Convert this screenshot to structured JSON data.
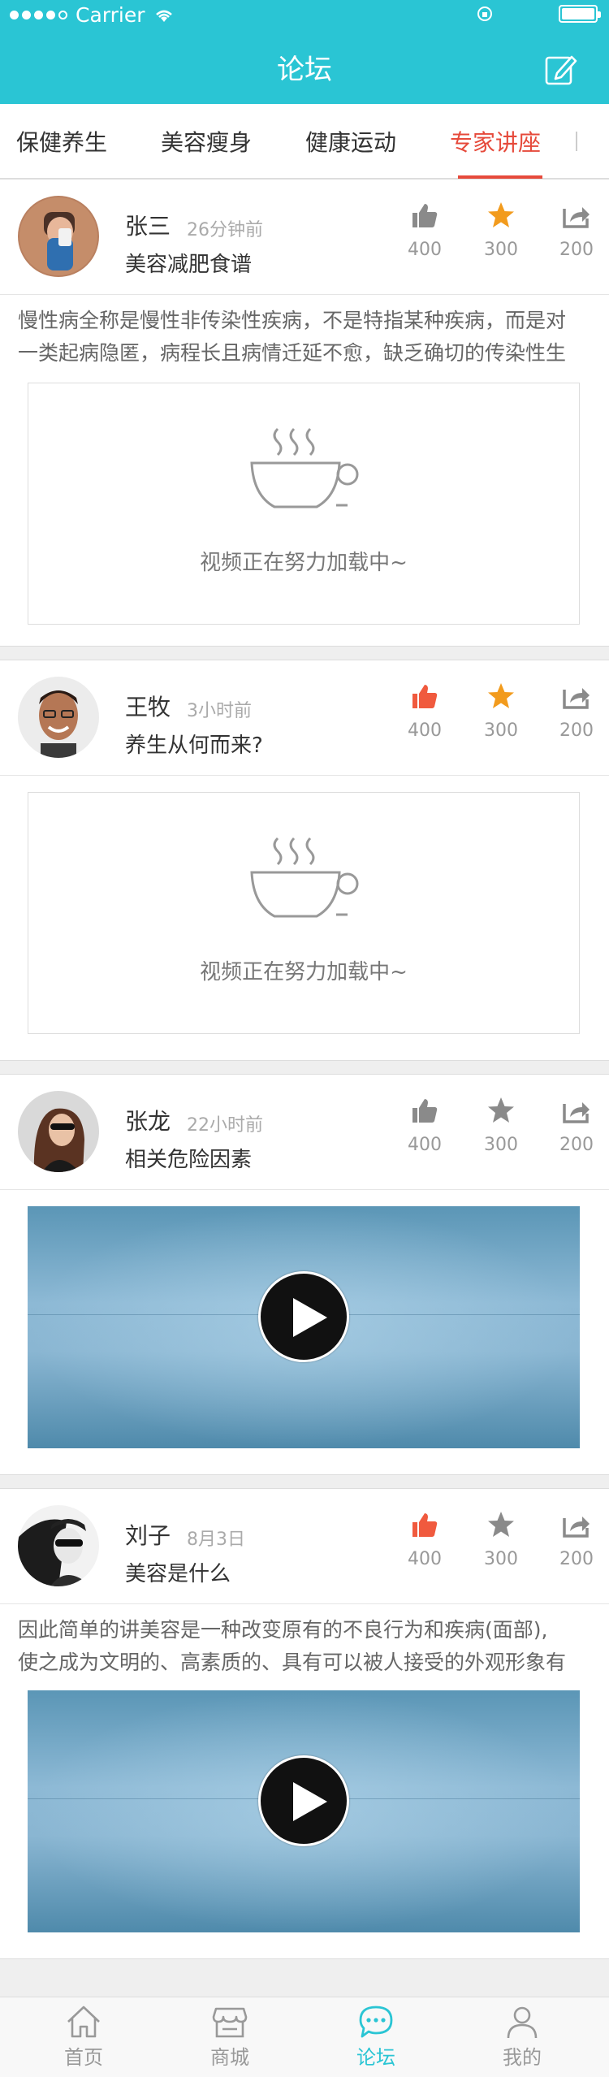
{
  "status_bar": {
    "carrier": "Carrier"
  },
  "nav": {
    "title": "论坛",
    "edit_icon": "edit-icon"
  },
  "tabs": [
    {
      "label": "保健养生",
      "active": false
    },
    {
      "label": "美容瘦身",
      "active": false
    },
    {
      "label": "健康运动",
      "active": false
    },
    {
      "label": "专家讲座",
      "active": true
    }
  ],
  "posts": [
    {
      "author": "张三",
      "time": "26分钟前",
      "subtitle": "美容减肥食谱",
      "likes": "400",
      "stars": "300",
      "shares": "200",
      "liked": false,
      "starred": true,
      "excerpt": "慢性病全称是慢性非传染性疾病，不是特指某种疾病，而是对一类起病隐匿，病程长且病情迁延不愈，缺乏确切的传染性生",
      "excerpt_line1": "慢性病全称是慢性非传染性疾病，不是特指某种疾病，而是对",
      "excerpt_line2": "一类起病隐匿，病程长且病情迁延不愈，缺乏确切的传染性生",
      "media": "loading",
      "loading_text": "视频正在努力加载中~"
    },
    {
      "author": "王牧",
      "time": "3小时前",
      "subtitle": "养生从何而来?",
      "likes": "400",
      "stars": "300",
      "shares": "200",
      "liked": true,
      "starred": true,
      "media": "loading",
      "loading_text": "视频正在努力加载中~"
    },
    {
      "author": "张龙",
      "time": "22小时前",
      "subtitle": "相关危险因素",
      "likes": "400",
      "stars": "300",
      "shares": "200",
      "liked": false,
      "starred": false,
      "media": "video"
    },
    {
      "author": "刘子",
      "time": "8月3日",
      "subtitle": "美容是什么",
      "likes": "400",
      "stars": "300",
      "shares": "200",
      "liked": true,
      "starred": false,
      "excerpt_line1": "因此简单的讲美容是一种改变原有的不良行为和疾病(面部),",
      "excerpt_line2": "使之成为文明的、高素质的、具有可以被人接受的外观形象有",
      "media": "video"
    }
  ],
  "bottom_nav": [
    {
      "label": "首页",
      "icon": "home-icon",
      "active": false
    },
    {
      "label": "商城",
      "icon": "shop-icon",
      "active": false
    },
    {
      "label": "论坛",
      "icon": "chat-icon",
      "active": true
    },
    {
      "label": "我的",
      "icon": "user-icon",
      "active": false
    }
  ],
  "colors": {
    "brand": "#2ac5d4",
    "accent": "#e64a3b",
    "star": "#f29b1d",
    "muted": "#999999"
  }
}
